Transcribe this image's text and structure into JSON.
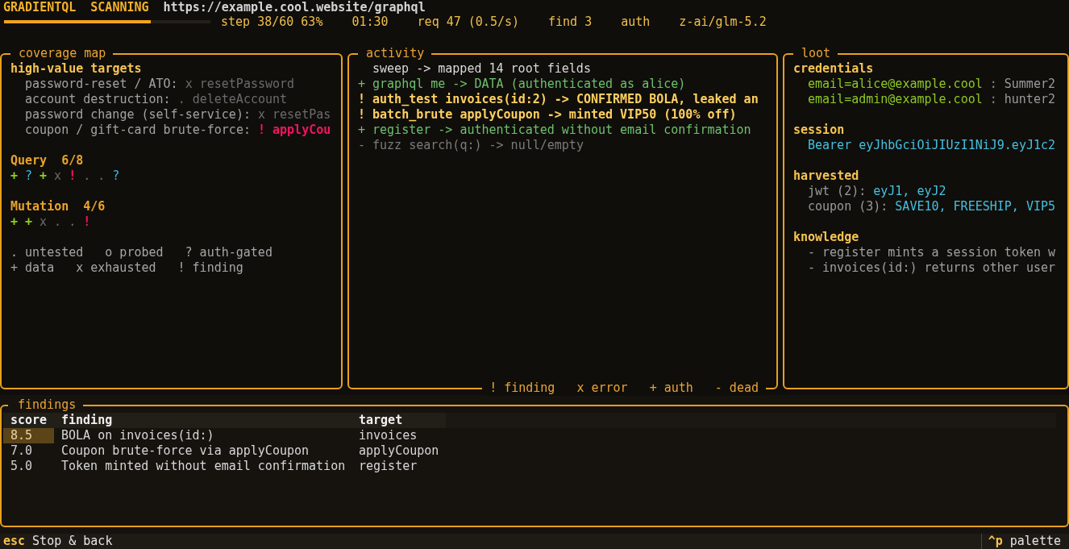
{
  "header": {
    "app_name": "GRADIENTQL",
    "status": "SCANNING",
    "url": "https://example.cool.website/graphql",
    "progress": {
      "level": 0.71
    },
    "stats": [
      "step 38/60 63%",
      "01:30",
      "req 47 (0.5/s)",
      "find 3",
      "auth",
      "z-ai/glm-5.2"
    ]
  },
  "coverage_map": {
    "title": "coverage map",
    "targets_heading": "high-value targets",
    "targets": [
      {
        "label": "password-reset / ATO:",
        "field": "x resetPassword",
        "kind": "exhausted"
      },
      {
        "label": "account destruction:",
        "field": ". deleteAccount",
        "kind": "untested"
      },
      {
        "label": "password change (self-service):",
        "field": "x resetPas",
        "kind": "exhausted"
      },
      {
        "label": "coupon / gift-card brute-force:",
        "field": "! applyCou",
        "kind": "finding"
      }
    ],
    "groups": [
      {
        "name": "Query",
        "count": "6/8",
        "marks": [
          {
            "symbol": "+",
            "kind": "data"
          },
          {
            "symbol": "?",
            "kind": "auth-gated"
          },
          {
            "symbol": "+",
            "kind": "data"
          },
          {
            "symbol": "x",
            "kind": "exhausted"
          },
          {
            "symbol": "!",
            "kind": "finding"
          },
          {
            "symbol": ".",
            "kind": "untested"
          },
          {
            "symbol": ".",
            "kind": "untested"
          },
          {
            "symbol": "?",
            "kind": "auth-gated"
          }
        ]
      },
      {
        "name": "Mutation",
        "count": "4/6",
        "marks": [
          {
            "symbol": "+",
            "kind": "data"
          },
          {
            "symbol": "+",
            "kind": "data"
          },
          {
            "symbol": "x",
            "kind": "exhausted"
          },
          {
            "symbol": ".",
            "kind": "untested"
          },
          {
            "symbol": ".",
            "kind": "untested"
          },
          {
            "symbol": "!",
            "kind": "finding"
          }
        ]
      }
    ],
    "legend": [
      [
        ". untested",
        "o probed",
        "? auth-gated"
      ],
      [
        "+ data",
        "x exhausted",
        "! finding"
      ]
    ]
  },
  "activity": {
    "title": "activity",
    "entries": [
      {
        "kind": "info",
        "text": "sweep -> mapped 14 root fields"
      },
      {
        "kind": "auth",
        "mark": "+",
        "text": "graphql me -> DATA (authenticated as alice)"
      },
      {
        "kind": "finding",
        "mark": "!",
        "text": "auth_test invoices(id:2) -> CONFIRMED BOLA, leaked an"
      },
      {
        "kind": "finding",
        "mark": "!",
        "text": "batch_brute applyCoupon -> minted VIP50 (100% off)"
      },
      {
        "kind": "auth",
        "mark": "+",
        "text": "register -> authenticated without email confirmation"
      },
      {
        "kind": "dead",
        "mark": "-",
        "text": "fuzz search(q:) -> null/empty"
      }
    ],
    "legend": [
      "! finding",
      "x error",
      "+ auth",
      "- dead"
    ]
  },
  "loot": {
    "title": "loot",
    "sections": [
      {
        "heading": "credentials",
        "items": [
          {
            "kind": "credential",
            "user": "email=alice@example.cool",
            "separator": ":",
            "secret": "Summer2"
          },
          {
            "kind": "credential",
            "user": "email=admin@example.cool",
            "separator": ":",
            "secret": "hunter2"
          }
        ]
      },
      {
        "heading": "session",
        "items": [
          {
            "kind": "token",
            "text": "Bearer eyJhbGciOiJIUzI1NiJ9.eyJ1c2"
          }
        ]
      },
      {
        "heading": "harvested",
        "items": [
          {
            "kind": "harvest",
            "label": "jwt (2):",
            "values": "eyJ1, eyJ2"
          },
          {
            "kind": "harvest",
            "label": "coupon (3):",
            "values": "SAVE10, FREESHIP, VIP5"
          }
        ]
      },
      {
        "heading": "knowledge",
        "items": [
          {
            "kind": "note",
            "text": "- register mints a session token w"
          },
          {
            "kind": "note",
            "text": "- invoices(id:) returns other user"
          }
        ]
      }
    ]
  },
  "findings": {
    "title": "findings",
    "columns": [
      "score",
      "finding",
      "target"
    ],
    "rows": [
      {
        "score": "8.5",
        "finding": "BOLA on invoices(id:)",
        "target": "invoices",
        "selected": true
      },
      {
        "score": "7.0",
        "finding": "Coupon brute-force via applyCoupon",
        "target": "applyCoupon",
        "selected": false
      },
      {
        "score": "5.0",
        "finding": "Token minted without email confirmation",
        "target": "register",
        "selected": false
      }
    ]
  },
  "status_bar": {
    "left": [
      {
        "key": "esc",
        "label": "Stop & back"
      }
    ],
    "right": [
      {
        "key": "^p",
        "label": "palette"
      }
    ]
  }
}
